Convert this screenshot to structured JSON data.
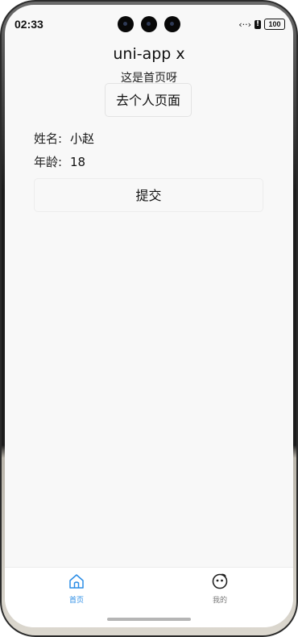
{
  "status_bar": {
    "time": "02:33",
    "icons_text": "‹··›",
    "battery": "100"
  },
  "navbar": {
    "title": "uni-app x"
  },
  "content": {
    "subtitle": "这是首页呀",
    "goto_button": "去个人页面",
    "form": [
      {
        "label": "姓名:",
        "value": "小赵"
      },
      {
        "label": "年龄:",
        "value": "18"
      }
    ],
    "submit_button": "提交"
  },
  "tabbar": {
    "active_color": "#2b8de6",
    "inactive_color": "#7a7a7a",
    "items": [
      {
        "label": "首页",
        "icon": "home-icon",
        "active": true
      },
      {
        "label": "我的",
        "icon": "smiley-icon",
        "active": false
      }
    ]
  }
}
